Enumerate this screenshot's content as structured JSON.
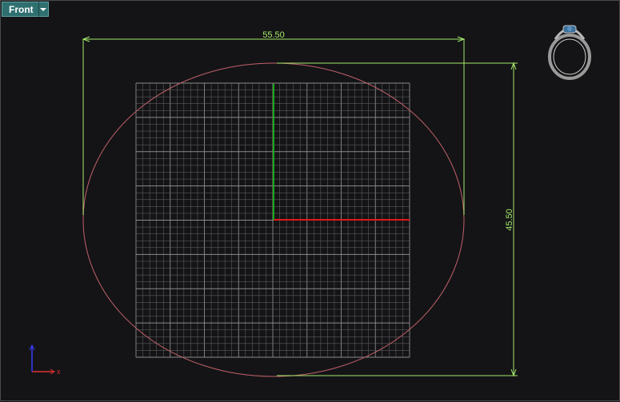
{
  "viewport": {
    "name": "Front",
    "dropdown_icon": "chevron-down-icon"
  },
  "dimensions": {
    "width_value": "55.50",
    "height_value": "45.50"
  },
  "axis_widget": {
    "x_label": "x",
    "x_color": "#e03030",
    "y_color": "#3a3aff"
  },
  "colors": {
    "background": "#141416",
    "grid": "#6a6a6a",
    "grid_major": "#8a8a8a",
    "x_axis": "#e01818",
    "y_axis": "#1aa81a",
    "ellipse": "#c0606a",
    "dimension": "#a6e86b",
    "tab": "#2f6f6f"
  },
  "preview_thumbnail": {
    "icon": "ring-preview-icon"
  }
}
